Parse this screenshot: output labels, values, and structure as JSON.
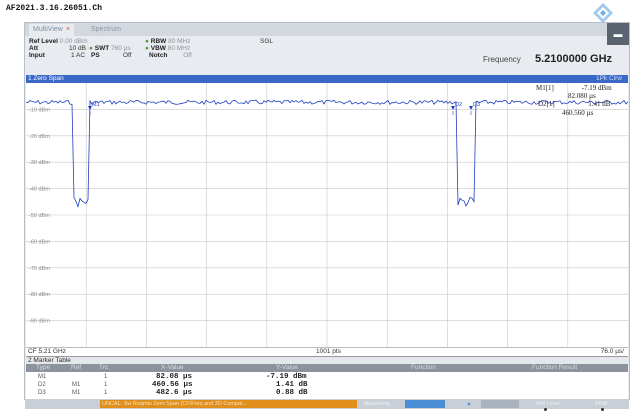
{
  "file_title": "AF2021.3.16.26051.Ch",
  "tabs": [
    {
      "label": "MultiView",
      "close": "×",
      "active": true
    },
    {
      "label": "Spectrum",
      "active": false
    }
  ],
  "params": {
    "ref_level_label": "Ref Level",
    "ref_level_value": "0.00 dBm",
    "att_label": "Att",
    "att_value": "10 dB",
    "swt_label": "SWT",
    "swt_value": "760 µs",
    "input_label": "Input",
    "input_value": "1 AC",
    "ps_label": "PS",
    "ps_value": "Off",
    "rbw_label": "RBW",
    "rbw_value": "80 MHz",
    "vbw_label": "VBW",
    "vbw_value": "80 MHz",
    "notch_label": "Notch",
    "notch_value": "Off",
    "sgl_label": "SGL"
  },
  "frequency": {
    "label": "Frequency",
    "value": "5.2100000 GHz"
  },
  "window": {
    "title": "1 Zero Span",
    "trace_mode": "1Pk Clrw"
  },
  "plot": {
    "y_labels": [
      "-10 dBm",
      "-20 dBm",
      "-30 dBm",
      "-40 dBm",
      "-50 dBm",
      "-60 dBm",
      "-70 dBm",
      "-80 dBm",
      "-90 dBm"
    ],
    "marker_tags": [
      "M1",
      "D2",
      "D3"
    ],
    "marker_readout": [
      {
        "name": "M1[1]",
        "value": "-7.19 dBm",
        "sub": "82.080 µs"
      },
      {
        "name": "D2[1]",
        "value": "1.41 dB",
        "sub": "460.560 µs"
      }
    ]
  },
  "axis_footer": {
    "center_freq": "CF 5.21 GHz",
    "points": "1001 pts",
    "per_div": "76.0 µs/"
  },
  "marker_table": {
    "title": "2 Marker Table",
    "columns": [
      "Type",
      "Ref",
      "Trc",
      "X-Value",
      "Y-Value",
      "Function",
      "Function Result"
    ],
    "rows": [
      {
        "type": "M1",
        "ref": "",
        "trc": "1",
        "x": "82.08 µs",
        "y": "-7.19 dBm"
      },
      {
        "type": "D2",
        "ref": "M1",
        "trc": "1",
        "x": "460.56 µs",
        "y": "1.41 dB"
      },
      {
        "type": "D3",
        "ref": "M1",
        "trc": "1",
        "x": "482.6 µs",
        "y": "0.88 dB"
      }
    ]
  },
  "status_bar": {
    "message": "UNCAL: Sw Reqmts Zero Span (CF/Freq and 3D Compat...",
    "items": [
      "Measuring...",
      "Ref Level",
      "RBW"
    ]
  },
  "colors": {
    "accent": "#3a68c8",
    "trace": "#1f3fbf",
    "status": "#e08e1c"
  }
}
